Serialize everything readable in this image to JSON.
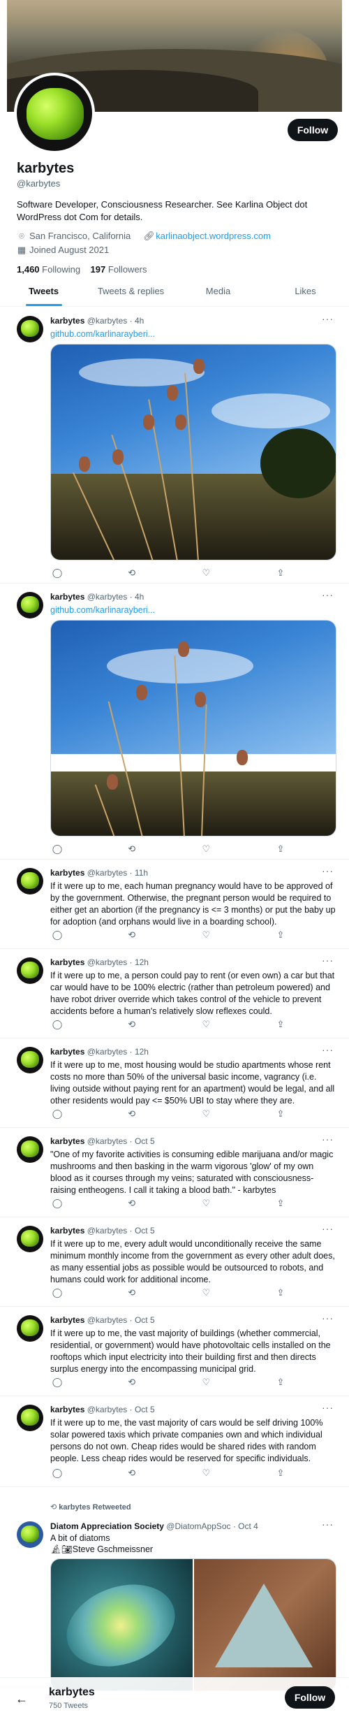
{
  "profile": {
    "name": "karbytes",
    "handle": "@karbytes",
    "bio": "Software Developer, Consciousness Researcher. See Karlina Object dot WordPress dot Com for details.",
    "location": "San Francisco, California",
    "website": "karlinaobject.wordpress.com",
    "joined": "Joined August 2021",
    "following_count": "1,460",
    "following_label": "Following",
    "followers_count": "197",
    "followers_label": "Followers",
    "follow_label": "Follow"
  },
  "tabs": [
    "Tweets",
    "Tweets & replies",
    "Media",
    "Likes"
  ],
  "tweets": [
    {
      "name": "karbytes",
      "handle": "@karbytes",
      "time": "4h",
      "text": "github.com/karlinarayberi..."
    },
    {
      "name": "karbytes",
      "handle": "@karbytes",
      "time": "4h",
      "text": "github.com/karlinarayberi..."
    },
    {
      "name": "karbytes",
      "handle": "@karbytes",
      "time": "11h",
      "text": "If it were up to me, each human pregnancy would have to be approved of by the government. Otherwise, the pregnant person would be required to either get an abortion (if the pregnancy is <= 3 months) or put the baby up for adoption (and orphans would live in a boarding school)."
    },
    {
      "name": "karbytes",
      "handle": "@karbytes",
      "time": "12h",
      "text": "If it were up to me, a person could pay to rent (or even own) a car but that car would have to be 100% electric (rather than petroleum powered) and have robot driver override which takes control of the vehicle to prevent accidents before a human's relatively slow reflexes could."
    },
    {
      "name": "karbytes",
      "handle": "@karbytes",
      "time": "12h",
      "text": "If it were up to me, most housing would be studio apartments whose rent costs no more than 50% of the universal basic income, vagrancy (i.e. living outside without paying rent for an apartment) would be legal, and all other residents would pay <= $50% UBI to stay where they are."
    },
    {
      "name": "karbytes",
      "handle": "@karbytes",
      "time": "Oct 5",
      "text": "\"One of my favorite activities is consuming edible marijuana and/or magic mushrooms and then basking in the warm vigorous 'glow' of my own blood as it courses through my veins; saturated with consciousness-raising entheogens. I call it taking a blood bath.\" - karbytes"
    },
    {
      "name": "karbytes",
      "handle": "@karbytes",
      "time": "Oct 5",
      "text": "If it were up to me, every adult would unconditionally receive the same minimum monthly income from the government as every other adult does, as many essential jobs as possible would be outsourced to robots, and humans could work for additional income."
    },
    {
      "name": "karbytes",
      "handle": "@karbytes",
      "time": "Oct 5",
      "text": "If it were up to me, the vast majority of buildings (whether commercial, residential, or government) would have photovoltaic cells installed on the rooftops which input electricity into their building first and then directs surplus energy into the encompassing municipal grid."
    },
    {
      "name": "karbytes",
      "handle": "@karbytes",
      "time": "Oct 5",
      "text": "If it were up to me, the vast majority of cars would be self driving 100% solar powered taxis which private companies own and which individual persons do not own. Cheap rides would be shared rides with random people. Less cheap rides would be reserved for specific individuals."
    }
  ],
  "retweet": {
    "label": "karbytes Retweeted",
    "name": "Diatom Appreciation Society",
    "handle": "@DiatomAppSoc",
    "time": "Oct 4",
    "text": "A bit of diatoms",
    "credit": "Steve Gschmeissner"
  },
  "sticky": {
    "name": "karbytes",
    "count": "750 Tweets",
    "follow_label": "Follow"
  },
  "icons": {
    "more": "more-dots-icon",
    "reply": "reply-icon",
    "retweet": "retweet-icon",
    "like": "like-icon",
    "share": "share-icon"
  },
  "colors": {
    "accent": "#1d9bf0",
    "text": "#0f1419",
    "muted": "#536471"
  }
}
